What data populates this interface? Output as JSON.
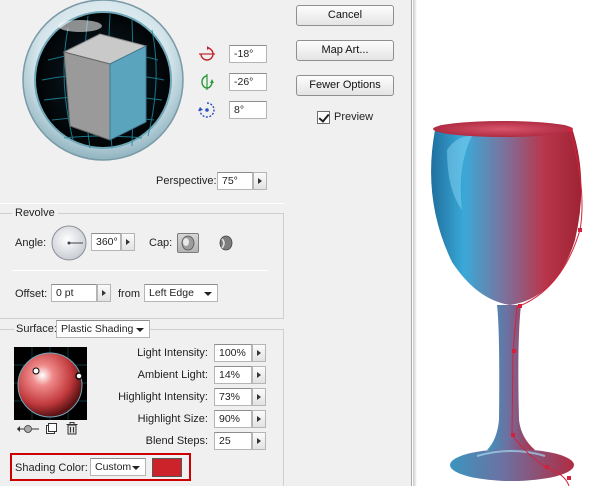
{
  "buttons": {
    "cancel": "Cancel",
    "map_art": "Map Art...",
    "fewer_options": "Fewer Options"
  },
  "preview": {
    "label": "Preview",
    "checked": true
  },
  "rotation": {
    "x_angle": "-18°",
    "y_angle": "-26°",
    "z_angle": "8°"
  },
  "perspective": {
    "label": "Perspective:",
    "value": "75°"
  },
  "revolve": {
    "title": "Revolve",
    "angle_label": "Angle:",
    "angle_value": "360°",
    "cap_label": "Cap:",
    "offset_label": "Offset:",
    "offset_value": "0 pt",
    "from_label": "from",
    "from_value": "Left Edge"
  },
  "surface": {
    "label": "Surface:",
    "value": "Plastic Shading",
    "light_intensity_label": "Light Intensity:",
    "light_intensity": "100%",
    "ambient_light_label": "Ambient Light:",
    "ambient_light": "14%",
    "highlight_intensity_label": "Highlight Intensity:",
    "highlight_intensity": "73%",
    "highlight_size_label": "Highlight Size:",
    "highlight_size": "90%",
    "blend_steps_label": "Blend Steps:",
    "blend_steps": "25",
    "shading_color_label": "Shading Color:",
    "shading_color_value": "Custom"
  },
  "colors": {
    "shading_color": "#cc2229",
    "highlight_box": "#cc0000",
    "cube_front": "#5ba4bd",
    "cube_side": "#9a9a9a",
    "cube_top": "#c9c9c9"
  }
}
